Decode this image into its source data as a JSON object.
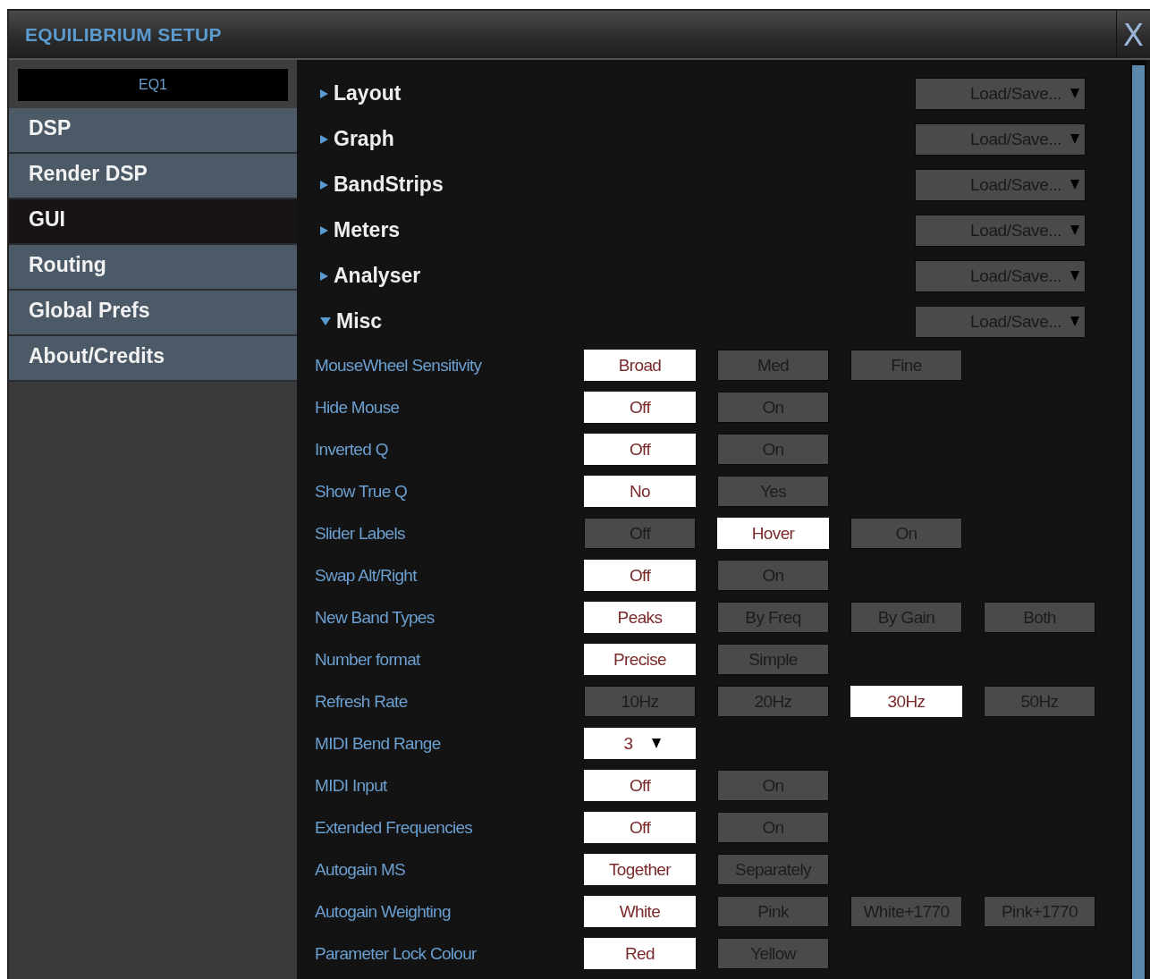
{
  "window": {
    "title": "EQUILIBRIUM SETUP",
    "close": "X"
  },
  "preset": {
    "name": "EQ1"
  },
  "sidebar": {
    "items": [
      {
        "label": "DSP",
        "selected": false
      },
      {
        "label": "Render DSP",
        "selected": false
      },
      {
        "label": "GUI",
        "selected": true
      },
      {
        "label": "Routing",
        "selected": false
      },
      {
        "label": "Global Prefs",
        "selected": false
      },
      {
        "label": "About/Credits",
        "selected": false
      }
    ]
  },
  "sections": [
    {
      "title": "Layout",
      "expanded": false,
      "menu": "Load/Save..."
    },
    {
      "title": "Graph",
      "expanded": false,
      "menu": "Load/Save..."
    },
    {
      "title": "BandStrips",
      "expanded": false,
      "menu": "Load/Save..."
    },
    {
      "title": "Meters",
      "expanded": false,
      "menu": "Load/Save..."
    },
    {
      "title": "Analyser",
      "expanded": false,
      "menu": "Load/Save..."
    },
    {
      "title": "Misc",
      "expanded": true,
      "menu": "Load/Save..."
    }
  ],
  "options": [
    {
      "label": "MouseWheel Sensitivity",
      "kind": "choice",
      "choices": [
        {
          "label": "Broad",
          "selected": true
        },
        {
          "label": "Med",
          "selected": false
        },
        {
          "label": "Fine",
          "selected": false
        }
      ]
    },
    {
      "label": "Hide Mouse",
      "kind": "choice",
      "choices": [
        {
          "label": "Off",
          "selected": true
        },
        {
          "label": "On",
          "selected": false
        }
      ]
    },
    {
      "label": "Inverted Q",
      "kind": "choice",
      "choices": [
        {
          "label": "Off",
          "selected": true
        },
        {
          "label": "On",
          "selected": false
        }
      ]
    },
    {
      "label": "Show True Q",
      "kind": "choice",
      "choices": [
        {
          "label": "No",
          "selected": true
        },
        {
          "label": "Yes",
          "selected": false
        }
      ]
    },
    {
      "label": "Slider Labels",
      "kind": "choice",
      "choices": [
        {
          "label": "Off",
          "selected": false
        },
        {
          "label": "Hover",
          "selected": true
        },
        {
          "label": "On",
          "selected": false
        }
      ]
    },
    {
      "label": "Swap Alt/Right",
      "kind": "choice",
      "choices": [
        {
          "label": "Off",
          "selected": true
        },
        {
          "label": "On",
          "selected": false
        }
      ]
    },
    {
      "label": "New Band Types",
      "kind": "choice",
      "choices": [
        {
          "label": "Peaks",
          "selected": true
        },
        {
          "label": "By Freq",
          "selected": false
        },
        {
          "label": "By Gain",
          "selected": false
        },
        {
          "label": "Both",
          "selected": false
        }
      ]
    },
    {
      "label": "Number format",
      "kind": "choice",
      "choices": [
        {
          "label": "Precise",
          "selected": true
        },
        {
          "label": "Simple",
          "selected": false
        }
      ]
    },
    {
      "label": "Refresh Rate",
      "kind": "choice",
      "choices": [
        {
          "label": "10Hz",
          "selected": false
        },
        {
          "label": "20Hz",
          "selected": false
        },
        {
          "label": "30Hz",
          "selected": true
        },
        {
          "label": "50Hz",
          "selected": false
        }
      ]
    },
    {
      "label": "MIDI Bend Range",
      "kind": "dropdown",
      "value": "3"
    },
    {
      "label": "MIDI Input",
      "kind": "choice",
      "choices": [
        {
          "label": "Off",
          "selected": true
        },
        {
          "label": "On",
          "selected": false
        }
      ]
    },
    {
      "label": "Extended Frequencies",
      "kind": "choice",
      "choices": [
        {
          "label": "Off",
          "selected": true
        },
        {
          "label": "On",
          "selected": false
        }
      ]
    },
    {
      "label": "Autogain MS",
      "kind": "choice",
      "choices": [
        {
          "label": "Together",
          "selected": true
        },
        {
          "label": "Separately",
          "selected": false
        }
      ]
    },
    {
      "label": "Autogain Weighting",
      "kind": "choice",
      "choices": [
        {
          "label": "White",
          "selected": true
        },
        {
          "label": "Pink",
          "selected": false
        },
        {
          "label": "White+1770",
          "selected": false
        },
        {
          "label": "Pink+1770",
          "selected": false
        }
      ]
    },
    {
      "label": "Parameter Lock Colour",
      "kind": "choice",
      "choices": [
        {
          "label": "Red",
          "selected": true
        },
        {
          "label": "Yellow",
          "selected": false
        }
      ]
    }
  ]
}
